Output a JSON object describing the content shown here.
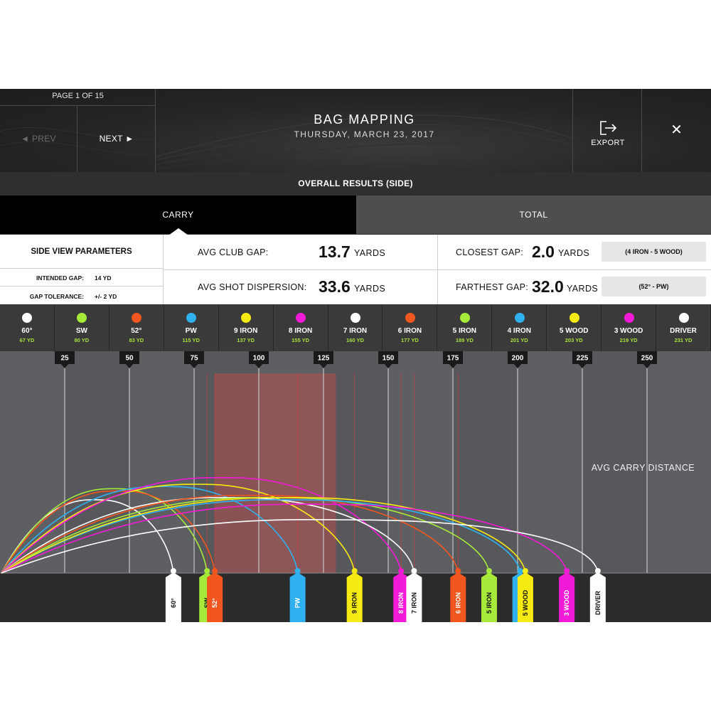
{
  "header": {
    "page_indicator": "PAGE 1 OF 15",
    "prev_label": "◄ PREV",
    "next_label": "NEXT ►",
    "title": "BAG MAPPING",
    "date": "THURSDAY, MARCH 23, 2017",
    "export_label": "EXPORT",
    "close_label": "✕",
    "subtitle": "OVERALL RESULTS (SIDE)"
  },
  "tabs": [
    {
      "label": "CARRY",
      "active": true
    },
    {
      "label": "TOTAL",
      "active": false
    }
  ],
  "params": {
    "title": "SIDE VIEW PARAMETERS",
    "intended_gap_label": "INTENDED GAP:",
    "intended_gap_value": "14 YD",
    "gap_tolerance_label": "GAP TOLERANCE:",
    "gap_tolerance_value": "+/- 2 YD"
  },
  "stats": {
    "avg_club_gap_label": "AVG CLUB GAP:",
    "avg_club_gap_value": "13.7",
    "avg_shot_dispersion_label": "AVG SHOT DISPERSION:",
    "avg_shot_dispersion_value": "33.6",
    "unit": "YARDS",
    "closest_gap_label": "CLOSEST GAP:",
    "closest_gap_value": "2.0",
    "closest_gap_clubs": "(4 IRON - 5 WOOD)",
    "farthest_gap_label": "FARTHEST GAP:",
    "farthest_gap_value": "32.0",
    "farthest_gap_clubs": "(52° - PW)"
  },
  "colors": {
    "white": "#ffffff",
    "green": "#a6ea3a",
    "orange": "#f0561e",
    "blue": "#2fb1f0",
    "yellow": "#f5ea12",
    "magenta": "#f21ad6",
    "highlight": "#b45050"
  },
  "clubs": [
    {
      "name": "60°",
      "yardage": "67 YD",
      "color": "#ffffff"
    },
    {
      "name": "SW",
      "yardage": "80 YD",
      "color": "#a6ea3a"
    },
    {
      "name": "52°",
      "yardage": "83 YD",
      "color": "#f0561e"
    },
    {
      "name": "PW",
      "yardage": "115 YD",
      "color": "#2fb1f0"
    },
    {
      "name": "9 IRON",
      "yardage": "137 YD",
      "color": "#f5ea12"
    },
    {
      "name": "8 IRON",
      "yardage": "155 YD",
      "color": "#f21ad6"
    },
    {
      "name": "7 IRON",
      "yardage": "160 YD",
      "color": "#ffffff"
    },
    {
      "name": "6 IRON",
      "yardage": "177 YD",
      "color": "#f0561e"
    },
    {
      "name": "5 IRON",
      "yardage": "189 YD",
      "color": "#a6ea3a"
    },
    {
      "name": "4 IRON",
      "yardage": "201 YD",
      "color": "#2fb1f0"
    },
    {
      "name": "5 WOOD",
      "yardage": "203 YD",
      "color": "#f5ea12"
    },
    {
      "name": "3 WOOD",
      "yardage": "219 YD",
      "color": "#f21ad6"
    },
    {
      "name": "DRIVER",
      "yardage": "231 YD",
      "color": "#ffffff"
    }
  ],
  "chart_data": {
    "type": "line",
    "title": "",
    "xlabel": "AVG CARRY DISTANCE",
    "ticks": [
      25,
      50,
      75,
      100,
      125,
      150,
      175,
      200,
      225,
      250
    ],
    "highlight_range": [
      83,
      115
    ],
    "series": [
      {
        "name": "60°",
        "carry": 67,
        "color": "#ffffff",
        "apex": 0.33
      },
      {
        "name": "SW",
        "carry": 80,
        "color": "#a6ea3a",
        "apex": 0.38
      },
      {
        "name": "52°",
        "carry": 83,
        "color": "#f0561e",
        "apex": 0.37
      },
      {
        "name": "PW",
        "carry": 115,
        "color": "#2fb1f0",
        "apex": 0.39
      },
      {
        "name": "9 IRON",
        "carry": 137,
        "color": "#f5ea12",
        "apex": 0.4
      },
      {
        "name": "8 IRON",
        "carry": 155,
        "color": "#f21ad6",
        "apex": 0.43
      },
      {
        "name": "7 IRON",
        "carry": 160,
        "color": "#ffffff",
        "apex": 0.34
      },
      {
        "name": "6 IRON",
        "carry": 177,
        "color": "#f0561e",
        "apex": 0.35
      },
      {
        "name": "5 IRON",
        "carry": 189,
        "color": "#a6ea3a",
        "apex": 0.34
      },
      {
        "name": "4 IRON",
        "carry": 201,
        "color": "#2fb1f0",
        "apex": 0.33
      },
      {
        "name": "5 WOOD",
        "carry": 203,
        "color": "#f5ea12",
        "apex": 0.34
      },
      {
        "name": "3 WOOD",
        "carry": 219,
        "color": "#f21ad6",
        "apex": 0.31
      },
      {
        "name": "DRIVER",
        "carry": 231,
        "color": "#ffffff",
        "apex": 0.24
      }
    ]
  }
}
